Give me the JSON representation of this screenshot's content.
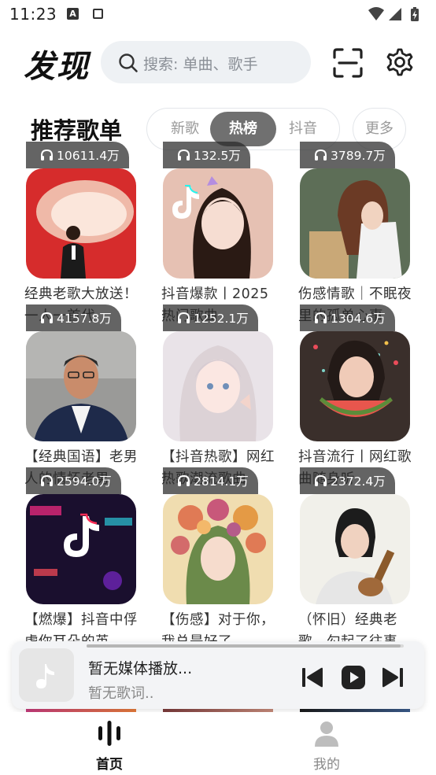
{
  "status": {
    "time": "11:23"
  },
  "header": {
    "title": "发现",
    "search_placeholder": "搜索: 单曲、歌手"
  },
  "section": {
    "title": "推荐歌单",
    "tabs": [
      "新歌",
      "热榜",
      "抖音"
    ],
    "active_tab": "热榜",
    "more_label": "更多"
  },
  "playlists": [
    {
      "count": "10611.4万",
      "title": "经典老歌大放送！一人一首代"
    },
    {
      "count": "132.5万",
      "title": "抖音爆款丨2025热门歌曲"
    },
    {
      "count": "3789.7万",
      "title": "伤感情歌｜不眠夜里的孤单心事"
    },
    {
      "count": "4157.8万",
      "title": "【经典国语】老男人的情怀老男"
    },
    {
      "count": "1252.1万",
      "title": "【抖音热歌】网红热歌潮流歌曲"
    },
    {
      "count": "1304.6万",
      "title": "抖音流行丨网红歌曲随身听"
    },
    {
      "count": "2594.0万",
      "title": "【燃爆】抖音中俘虏你耳朵的英"
    },
    {
      "count": "2814.1万",
      "title": "【伤感】对于你，我总是好了"
    },
    {
      "count": "2372.4万",
      "title": "（怀旧）经典老歌，勾起了往事"
    }
  ],
  "player": {
    "title": "暂无媒体播放...",
    "lyric": "暂无歌词..",
    "progress": 0.99
  },
  "nav": {
    "home_label": "首页",
    "mine_label": "我的"
  },
  "colors": {
    "active_tab_bg": "#707070",
    "search_bg": "#eef1f4",
    "player_bg": "#f3f4f6"
  }
}
